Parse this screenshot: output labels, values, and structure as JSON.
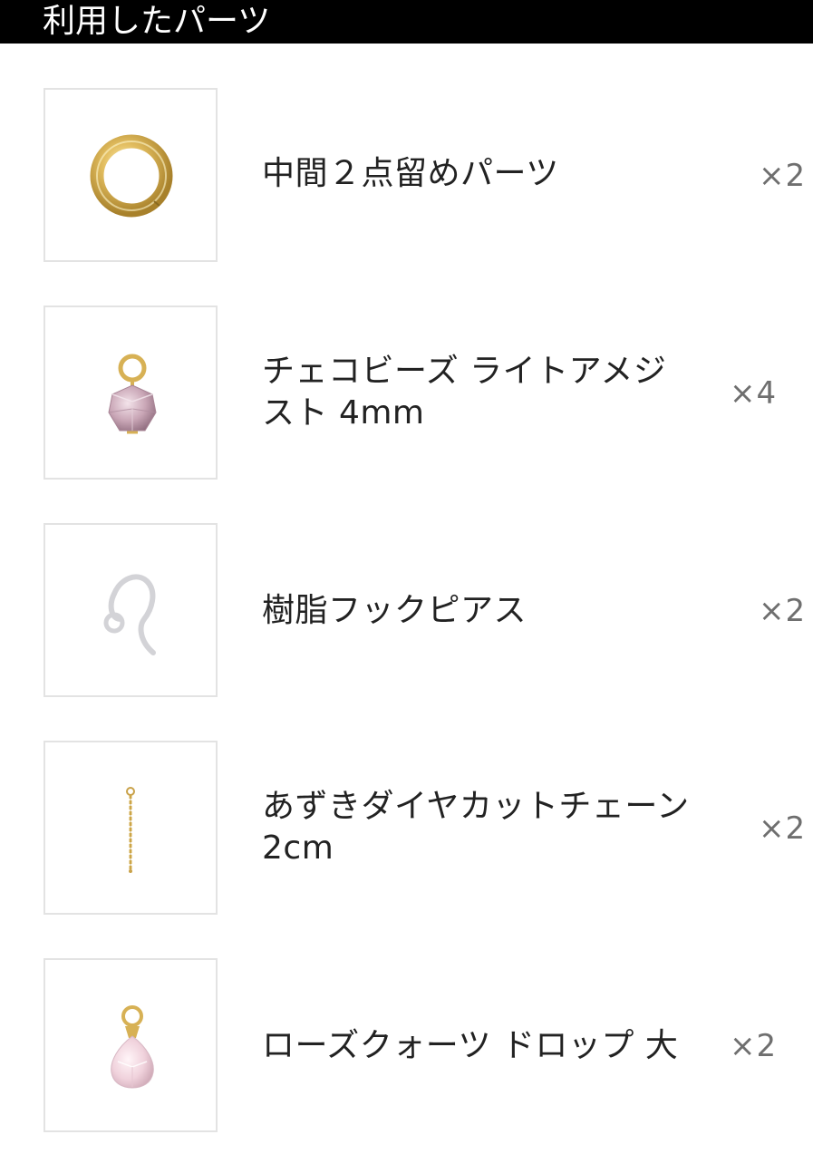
{
  "header": {
    "title": "利用したパーツ"
  },
  "parts": [
    {
      "name": "中間２点留めパーツ",
      "quantity": "×2",
      "icon": "gold-jump-ring-icon"
    },
    {
      "name": "チェコビーズ ライトアメジスト 4mm",
      "quantity": "×4",
      "icon": "amethyst-bead-icon"
    },
    {
      "name": "樹脂フックピアス",
      "quantity": "×2",
      "icon": "resin-hook-earring-icon"
    },
    {
      "name": "あずきダイヤカットチェーン 2cm",
      "quantity": "×2",
      "icon": "chain-icon"
    },
    {
      "name": "ローズクォーツ ドロップ 大",
      "quantity": "×2",
      "icon": "rose-quartz-drop-icon"
    }
  ],
  "colors": {
    "header_bg": "#000000",
    "header_text": "#ffffff",
    "thumb_border": "#e3e3e3",
    "quantity_text": "#6f6f6f",
    "gold": "#d9b45a",
    "amethyst": "#c9a6b6",
    "rose_quartz": "#f1d3dc"
  }
}
